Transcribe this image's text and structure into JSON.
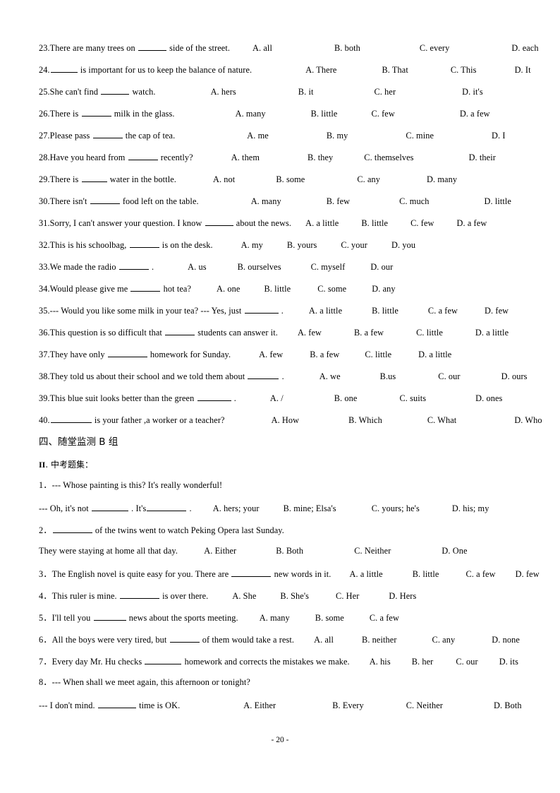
{
  "document": {
    "footer": "- 20 -",
    "section_a_heading": "四、随堂监测 B 组",
    "section_b_label_roman": "II",
    "section_b_label_text": ". 中考题集："
  },
  "questions_part1": [
    {
      "num": "23.",
      "text_before": "There are many trees on",
      "text_after": "side of the street.",
      "blank_width": 40,
      "gap_after_stem": 26,
      "options": [
        {
          "label": "A. all",
          "gap": 0
        },
        {
          "label": "B. both",
          "gap": 82
        },
        {
          "label": "C. every",
          "gap": 78
        },
        {
          "label": "D. each",
          "gap": 82
        }
      ]
    },
    {
      "num": "24.",
      "text_before": "",
      "text_after": "is important for us to keep the balance of nature.",
      "blank_width": 38,
      "gap_after_stem": 70,
      "options": [
        {
          "label": "A. There",
          "gap": 0
        },
        {
          "label": "B. That",
          "gap": 58
        },
        {
          "label": "C. This",
          "gap": 54
        },
        {
          "label": "D. It",
          "gap": 48
        }
      ]
    },
    {
      "num": "25.",
      "text_before": "She can't find",
      "text_after": "watch.",
      "blank_width": 40,
      "gap_after_stem": 72,
      "options": [
        {
          "label": "A. hers",
          "gap": 0
        },
        {
          "label": "B. it",
          "gap": 82
        },
        {
          "label": "C. her",
          "gap": 80
        },
        {
          "label": "D. it's",
          "gap": 88
        }
      ]
    },
    {
      "num": "26.",
      "text_before": "There is",
      "text_after": "milk in the glass.",
      "blank_width": 42,
      "gap_after_stem": 80,
      "options": [
        {
          "label": "A. many",
          "gap": 0
        },
        {
          "label": "B. little",
          "gap": 58
        },
        {
          "label": "C. few",
          "gap": 42
        },
        {
          "label": "D. a few",
          "gap": 86
        }
      ]
    },
    {
      "num": "27.",
      "text_before": "Please pass",
      "text_after": "the cap of tea.",
      "blank_width": 42,
      "gap_after_stem": 96,
      "options": [
        {
          "label": "A. me",
          "gap": 0
        },
        {
          "label": "B. my",
          "gap": 76
        },
        {
          "label": "C. mine",
          "gap": 76
        },
        {
          "label": "D. I",
          "gap": 76
        }
      ]
    },
    {
      "num": "28.",
      "text_before": "Have you heard from",
      "text_after": "recently?",
      "blank_width": 42,
      "gap_after_stem": 48,
      "options": [
        {
          "label": "A. them",
          "gap": 0
        },
        {
          "label": "B. they",
          "gap": 62
        },
        {
          "label": "C. themselves",
          "gap": 38
        },
        {
          "label": "D. their",
          "gap": 72
        }
      ]
    },
    {
      "num": "29.",
      "text_before": "There is",
      "text_after": "water in the bottle.",
      "blank_width": 36,
      "gap_after_stem": 46,
      "options": [
        {
          "label": "A. not",
          "gap": 0
        },
        {
          "label": "B. some",
          "gap": 52
        },
        {
          "label": "C. any",
          "gap": 68
        },
        {
          "label": "D. many",
          "gap": 60
        }
      ]
    },
    {
      "num": "30.",
      "text_before": "There isn't",
      "text_after": "food left on the table.",
      "blank_width": 42,
      "gap_after_stem": 68,
      "options": [
        {
          "label": "A. many",
          "gap": 0
        },
        {
          "label": "B. few",
          "gap": 58
        },
        {
          "label": "C. much",
          "gap": 64
        },
        {
          "label": "D. little",
          "gap": 72
        }
      ]
    },
    {
      "num": "31.",
      "text_before": "Sorry, I can't answer your question. I know",
      "text_after": "about the news.",
      "blank_width": 40,
      "gap_after_stem": 14,
      "options": [
        {
          "label": "A. a little",
          "gap": 0
        },
        {
          "label": "B. little",
          "gap": 26
        },
        {
          "label": "C. few",
          "gap": 26
        },
        {
          "label": "D. a few",
          "gap": 26
        }
      ]
    },
    {
      "num": "32.",
      "text_before": "This is his schoolbag,",
      "text_after": "is on the desk.",
      "blank_width": 42,
      "gap_after_stem": 34,
      "options": [
        {
          "label": "A. my",
          "gap": 0
        },
        {
          "label": "B. yours",
          "gap": 28
        },
        {
          "label": "C. your",
          "gap": 28
        },
        {
          "label": "D. you",
          "gap": 28
        }
      ]
    },
    {
      "num": "33.",
      "text_before": "We made the radio",
      "text_after": ".",
      "blank_width": 42,
      "gap_after_stem": 42,
      "options": [
        {
          "label": "A. us",
          "gap": 0
        },
        {
          "label": "B. ourselves",
          "gap": 38
        },
        {
          "label": "C. myself",
          "gap": 36
        },
        {
          "label": "D. our",
          "gap": 30
        }
      ]
    },
    {
      "num": "34.",
      "text_before": "Would please give me",
      "text_after": "hot tea?",
      "blank_width": 42,
      "gap_after_stem": 30,
      "options": [
        {
          "label": "A. one",
          "gap": 0
        },
        {
          "label": "B. little",
          "gap": 28
        },
        {
          "label": "C. some",
          "gap": 32
        },
        {
          "label": "D. any",
          "gap": 30
        }
      ]
    },
    {
      "num": "35.",
      "text_before": "--- Would you like some milk in your tea? --- Yes, just",
      "text_after": ".",
      "blank_width": 48,
      "gap_after_stem": 30,
      "options": [
        {
          "label": "A. a little",
          "gap": 0
        },
        {
          "label": "B. little",
          "gap": 36
        },
        {
          "label": "C. a few",
          "gap": 36
        },
        {
          "label": "D. few",
          "gap": 32
        }
      ]
    },
    {
      "num": "36.",
      "text_before": "This question is so difficult that",
      "text_after": "students can answer it.",
      "blank_width": 42,
      "gap_after_stem": 22,
      "options": [
        {
          "label": "A. few",
          "gap": 0
        },
        {
          "label": "B. a few",
          "gap": 40
        },
        {
          "label": "C. little",
          "gap": 40
        },
        {
          "label": "D. a little",
          "gap": 40
        }
      ]
    },
    {
      "num": "37.",
      "text_before": "They have only",
      "text_after": "homework for Sunday.",
      "blank_width": 56,
      "gap_after_stem": 34,
      "options": [
        {
          "label": "A. few",
          "gap": 0
        },
        {
          "label": "B. a few",
          "gap": 32
        },
        {
          "label": "C. little",
          "gap": 30
        },
        {
          "label": "D. a little",
          "gap": 32
        }
      ]
    },
    {
      "num": "38.",
      "text_before": "They told us about their school and we told them about",
      "text_after": ".",
      "blank_width": 44,
      "gap_after_stem": 44,
      "options": [
        {
          "label": "A. we",
          "gap": 0
        },
        {
          "label": "B.us",
          "gap": 50
        },
        {
          "label": "C. our",
          "gap": 54
        },
        {
          "label": "D. ours",
          "gap": 52
        }
      ]
    },
    {
      "num": "39.",
      "text_before": "This blue suit looks better than the green",
      "text_after": ".",
      "blank_width": 48,
      "gap_after_stem": 42,
      "options": [
        {
          "label": "A. /",
          "gap": 0
        },
        {
          "label": "B. one",
          "gap": 66
        },
        {
          "label": "C. suits",
          "gap": 54
        },
        {
          "label": "D. ones",
          "gap": 64
        }
      ]
    },
    {
      "num": "40.",
      "text_before": "",
      "text_after": "is your father ,a worker or a teacher?",
      "blank_width": 58,
      "gap_after_stem": 60,
      "options": [
        {
          "label": "A. How",
          "gap": 0
        },
        {
          "label": "B. Which",
          "gap": 64
        },
        {
          "label": "C. What",
          "gap": 58
        },
        {
          "label": "D. Who",
          "gap": 76
        }
      ]
    }
  ],
  "questions_part2": [
    {
      "lines": [
        {
          "num": "1．",
          "text_before": "--- Whose painting is this? It's really wonderful!",
          "text_after": "",
          "blank_width": 0,
          "gap_after_stem": 0,
          "options": []
        },
        {
          "num": "",
          "text_before": "--- Oh, it's not",
          "text_after": ". It's",
          "blank_width": 52,
          "blank_width2": 56,
          "text_end": ".",
          "gap_after_stem": 24,
          "options": [
            {
              "label": "A. hers; your",
              "gap": 0
            },
            {
              "label": "B. mine; Elsa's",
              "gap": 28
            },
            {
              "label": "C. yours; he's",
              "gap": 44
            },
            {
              "label": "D. his; my",
              "gap": 40
            }
          ]
        }
      ]
    },
    {
      "lines": [
        {
          "num": "2．",
          "text_before": "",
          "text_after": "of the twins went to watch Peking Opera last Sunday.",
          "blank_width": 56,
          "gap_after_stem": 0,
          "options": []
        },
        {
          "num": "",
          "text_before": "They were staying at home all that day.",
          "text_after": "",
          "blank_width": 0,
          "gap_after_stem": 28,
          "options": [
            {
              "label": "A. Either",
              "gap": 0
            },
            {
              "label": "B. Both",
              "gap": 50
            },
            {
              "label": "C. Neither",
              "gap": 66
            },
            {
              "label": "D. One",
              "gap": 66
            }
          ]
        }
      ]
    },
    {
      "lines": [
        {
          "num": "3．",
          "text_before": "The English novel is quite easy for you. There are",
          "text_after": "new words in it.",
          "blank_width": 56,
          "gap_after_stem": 20,
          "options": [
            {
              "label": "A. a little",
              "gap": 0
            },
            {
              "label": "B. little",
              "gap": 36
            },
            {
              "label": "C. a few",
              "gap": 32
            },
            {
              "label": "D. few",
              "gap": 22
            }
          ]
        }
      ]
    },
    {
      "lines": [
        {
          "num": "4．",
          "text_before": "This ruler is mine.",
          "text_after": "is over there.",
          "blank_width": 56,
          "gap_after_stem": 28,
          "options": [
            {
              "label": "A. She",
              "gap": 0
            },
            {
              "label": "B. She's",
              "gap": 28
            },
            {
              "label": "C. Her",
              "gap": 32
            },
            {
              "label": "D. Hers",
              "gap": 36
            }
          ]
        }
      ]
    },
    {
      "lines": [
        {
          "num": "5．",
          "text_before": "I'll tell you",
          "text_after": "news about the sports meeting.",
          "blank_width": 46,
          "gap_after_stem": 24,
          "options": [
            {
              "label": "A. many",
              "gap": 0
            },
            {
              "label": "B. some",
              "gap": 30
            },
            {
              "label": "C. a few",
              "gap": 30
            }
          ]
        }
      ]
    },
    {
      "lines": [
        {
          "num": "6．",
          "text_before": "All the boys were very tired, but",
          "text_after": "of them would take a rest.",
          "blank_width": 42,
          "gap_after_stem": 22,
          "options": [
            {
              "label": "A. all",
              "gap": 0
            },
            {
              "label": "B. neither",
              "gap": 34
            },
            {
              "label": "C. any",
              "gap": 44
            },
            {
              "label": "D. none",
              "gap": 46
            }
          ]
        }
      ]
    },
    {
      "lines": [
        {
          "num": "7．",
          "text_before": "Every day Mr. Hu checks",
          "text_after": "homework and corrects the mistakes we make.",
          "blank_width": 52,
          "gap_after_stem": 22,
          "options": [
            {
              "label": "A. his",
              "gap": 0
            },
            {
              "label": "B. her",
              "gap": 24
            },
            {
              "label": "C. our",
              "gap": 26
            },
            {
              "label": "D. its",
              "gap": 24
            }
          ]
        }
      ]
    },
    {
      "lines": [
        {
          "num": "8．",
          "text_before": "--- When shall we meet again, this afternoon or tonight?",
          "text_after": "",
          "blank_width": 0,
          "gap_after_stem": 0,
          "options": []
        },
        {
          "num": "",
          "text_before": "--- I don't mind.",
          "text_after": "time is OK.",
          "blank_width": 54,
          "gap_after_stem": 84,
          "options": [
            {
              "label": "A. Either",
              "gap": 0
            },
            {
              "label": "B. Every",
              "gap": 74
            },
            {
              "label": "C. Neither",
              "gap": 54
            },
            {
              "label": "D. Both",
              "gap": 66
            }
          ]
        }
      ]
    }
  ]
}
